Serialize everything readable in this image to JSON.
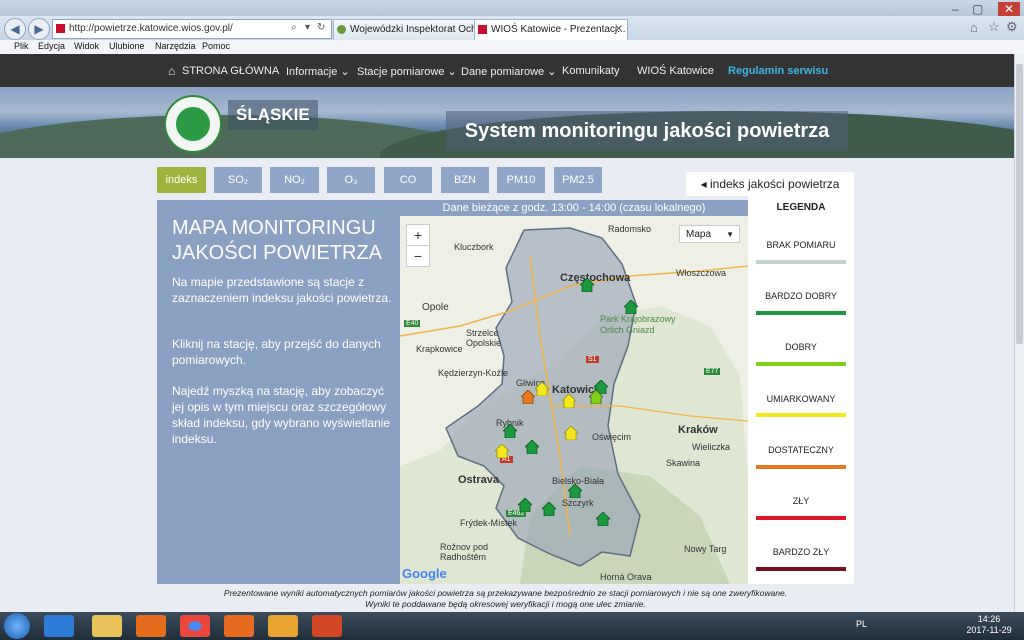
{
  "browser": {
    "url": "http://powietrze.katowice.wios.gov.pl/",
    "tabs": [
      {
        "label": "Wojewódzki Inspektorat Ochro...",
        "active": false
      },
      {
        "label": "WIOŚ Katowice - Prezentacj...",
        "active": true
      }
    ],
    "menu": [
      "Plik",
      "Edycja",
      "Widok",
      "Ulubione",
      "Narzędzia",
      "Pomoc"
    ]
  },
  "site_nav": {
    "home": "STRONA GŁÓWNA",
    "items": [
      "Informacje ⌄",
      "Stacje pomiarowe ⌄",
      "Dane pomiarowe ⌄",
      "Komunikaty",
      "WIOŚ Katowice"
    ],
    "rules": "Regulamin serwisu"
  },
  "banner": {
    "region": "ŚLĄSKIE",
    "title": "System monitoringu jakości powietrza"
  },
  "pollutant_tabs": [
    {
      "label": "indeks",
      "active": true
    },
    {
      "label": "SO₂",
      "active": false
    },
    {
      "label": "NO₂",
      "active": false
    },
    {
      "label": "O₃",
      "active": false
    },
    {
      "label": "CO",
      "active": false
    },
    {
      "label": "BZN",
      "active": false
    },
    {
      "label": "PM10",
      "active": false
    },
    {
      "label": "PM2.5",
      "active": false
    }
  ],
  "legend_toggle": "◂  indeks jakości powietrza",
  "info": {
    "title": "MAPA MONITORINGU JAKOŚCI POWIETRZA",
    "p1": "Na mapie przedstawione są stacje z zaznaczeniem indeksu jakości powietrza.",
    "p2": "Kliknij na stację, aby przejść do danych pomiarowych.",
    "p3": "Najedź myszką na stację, aby zobaczyć jej opis w tym miejscu oraz szczegółowy skład indeksu, gdy wybrano wyświetlanie indeksu."
  },
  "map": {
    "header": "Dane bieżące z godz. 13:00 - 14:00 (czasu lokalnego)",
    "zoom_in": "+",
    "zoom_out": "−",
    "map_type": "Mapa",
    "google": "Google",
    "cities": {
      "kluczbork": "Kluczbork",
      "radomsko": "Radomsko",
      "czestochowa": "Częstochowa",
      "wloszczowa": "Włoszczowa",
      "opole": "Opole",
      "park": "Park Krajobrazowy Orlich Gniazd",
      "strzelce": "Strzelce Opolskie",
      "krapkowice": "Krapkowice",
      "kedzierzyn": "Kędzierzyn-Koźle",
      "gliwice": "Gliwice",
      "katowice": "Katowice",
      "krakow": "Kraków",
      "wieliczka": "Wieliczka",
      "rybnik": "Rybnik",
      "oswiecim": "Oświęcim",
      "ostrava": "Ostrava",
      "skawina": "Skawina",
      "bielsko": "Bielsko-Biała",
      "szczyrk": "Szczyrk",
      "frydek": "Frýdek-Místek",
      "roznov": "Rožnov pod Radhoštěm",
      "nowytarg": "Nowy Targ",
      "horna": "Horná Orava"
    },
    "road_labels": {
      "e40": "E40",
      "e462": "E462",
      "e77": "E77",
      "a1": "A1",
      "s1": "S1"
    }
  },
  "legend": {
    "title": "LEGENDA",
    "levels": [
      {
        "label": "BRAK POMIARU",
        "color": "#c5d3cf"
      },
      {
        "label": "BARDZO DOBRY",
        "color": "#1a9a3c"
      },
      {
        "label": "DOBRY",
        "color": "#7fd11b"
      },
      {
        "label": "UMIARKOWANY",
        "color": "#f4e71c"
      },
      {
        "label": "DOSTATECZNY",
        "color": "#e6771d"
      },
      {
        "label": "ZŁY",
        "color": "#d9162c"
      },
      {
        "label": "BARDZO ZŁY",
        "color": "#7a0f24"
      }
    ]
  },
  "disclaimer": {
    "line1": "Prezentowane wyniki automatycznych pomiarów jakości powietrza są przekazywane bezpośrednio ze stacji pomiarowych i nie są one zweryfikowane.",
    "line2": "Wyniki te poddawane będą okresowej weryfikacji i mogą one ulec zmianie."
  },
  "taskbar": {
    "lang": "PL",
    "time": "14:26",
    "date": "2017-11-29"
  }
}
